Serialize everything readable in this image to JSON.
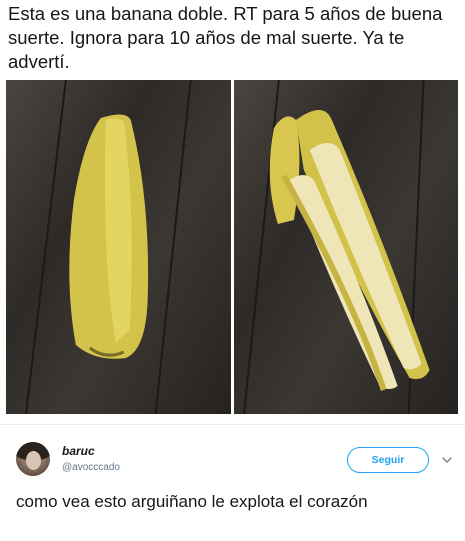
{
  "tweet": {
    "text": "Esta es una banana doble. RT para 5 años de buena suerte. Ignora para 10 años de mal suerte. Ya te advertí."
  },
  "reply": {
    "display_name": "baruc",
    "handle": "@avocccado",
    "follow_label": "Seguir",
    "text": "como vea esto arguiñano le explota el corazón"
  },
  "icons": {
    "chevron": "chevron-down-icon",
    "avatar": "avatar"
  },
  "colors": {
    "accent": "#1da1f2",
    "muted": "#657786",
    "text": "#14171a"
  }
}
